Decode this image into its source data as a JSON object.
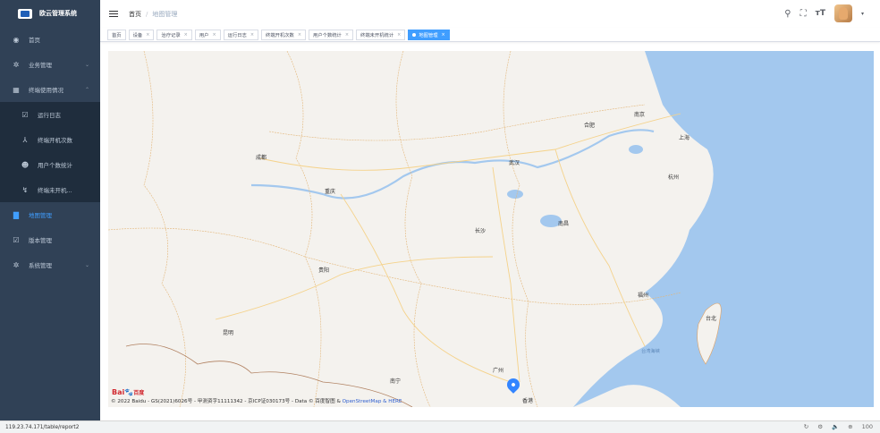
{
  "app": {
    "name": "欧云管理系统"
  },
  "sidebar": {
    "items": [
      {
        "label": "首页",
        "icon": "dashboard-icon"
      },
      {
        "label": "业务管理",
        "icon": "gear-icon"
      },
      {
        "label": "终端使用情况",
        "icon": "grid-icon"
      },
      {
        "label": "运行日志",
        "icon": "edit-icon"
      },
      {
        "label": "终端开机次数",
        "icon": "chart-icon"
      },
      {
        "label": "用户个数统计",
        "icon": "users-icon"
      },
      {
        "label": "终端未开机...",
        "icon": "trend-icon"
      },
      {
        "label": "地图管理",
        "icon": "map-icon"
      },
      {
        "label": "版本管理",
        "icon": "edit-icon"
      },
      {
        "label": "系统管理",
        "icon": "gear-icon"
      }
    ]
  },
  "header": {
    "breadcrumb_home": "首页",
    "breadcrumb_sep": "/",
    "breadcrumb_current": "地图管理"
  },
  "tags": [
    {
      "label": "首页"
    },
    {
      "label": "设备"
    },
    {
      "label": "治疗记录"
    },
    {
      "label": "用户"
    },
    {
      "label": "运行日志"
    },
    {
      "label": "终端开机次数"
    },
    {
      "label": "用户个数统计"
    },
    {
      "label": "终端未开机统计"
    },
    {
      "label": "地图管理"
    }
  ],
  "map": {
    "cities": [
      {
        "name": "成都"
      },
      {
        "name": "重庆"
      },
      {
        "name": "贵阳"
      },
      {
        "name": "昆明"
      },
      {
        "name": "长沙"
      },
      {
        "name": "武汉"
      },
      {
        "name": "南昌"
      },
      {
        "name": "合肥"
      },
      {
        "name": "南京"
      },
      {
        "name": "上海"
      },
      {
        "name": "杭州"
      },
      {
        "name": "福州"
      },
      {
        "name": "台北"
      },
      {
        "name": "广州"
      },
      {
        "name": "南宁"
      },
      {
        "name": "香港"
      },
      {
        "name": "台湾海峡"
      }
    ],
    "copyright_text": "© 2022 Baidu - GS(2021)6026号 - 甲测资字11111342 - 京ICP证030173号 - Data © 百度智图 & ",
    "copyright_links": "OpenStreetMap & HERE",
    "logo_text": "Bai",
    "logo_text2": "百度"
  },
  "statusbar": {
    "url": "119.23.74.171/table/report2",
    "zoom": "100"
  },
  "colors": {
    "sidebar_bg": "#304156",
    "active": "#409eff",
    "water": "#a3c8ee"
  }
}
